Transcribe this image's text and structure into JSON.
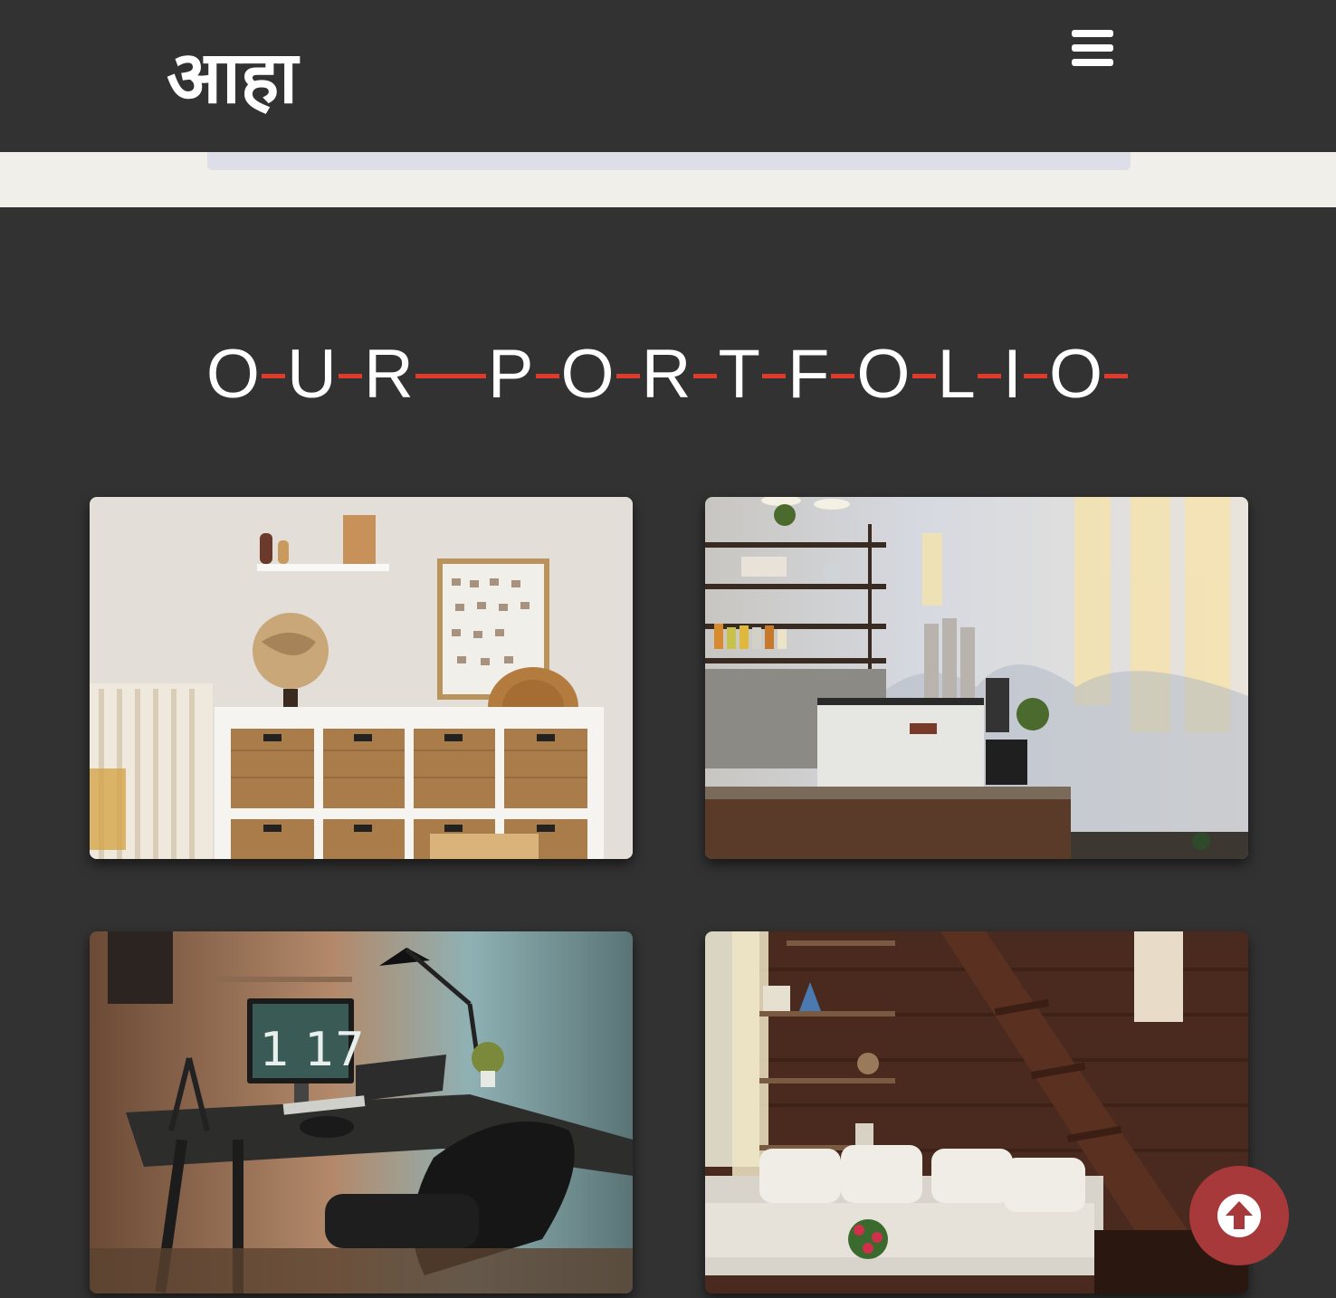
{
  "header": {
    "logo": "आहा",
    "menu_icon": "hamburger-menu-icon"
  },
  "portfolio": {
    "title_letters": [
      "O",
      "U",
      "R",
      "P",
      "O",
      "R",
      "T",
      "F",
      "O",
      "L",
      "I",
      "O"
    ],
    "accent_color": "#e03a2b",
    "items": [
      {
        "subject": "nursery room with wicker storage shelf and globe"
      },
      {
        "subject": "coffee shop counter with espresso machine"
      },
      {
        "subject": "home office desk with monitor and lamp"
      },
      {
        "subject": "wooden cabin loft with sofa and shelves"
      }
    ]
  },
  "scroll_top": {
    "icon": "arrow-up-circle-icon",
    "color": "#a8393b"
  }
}
